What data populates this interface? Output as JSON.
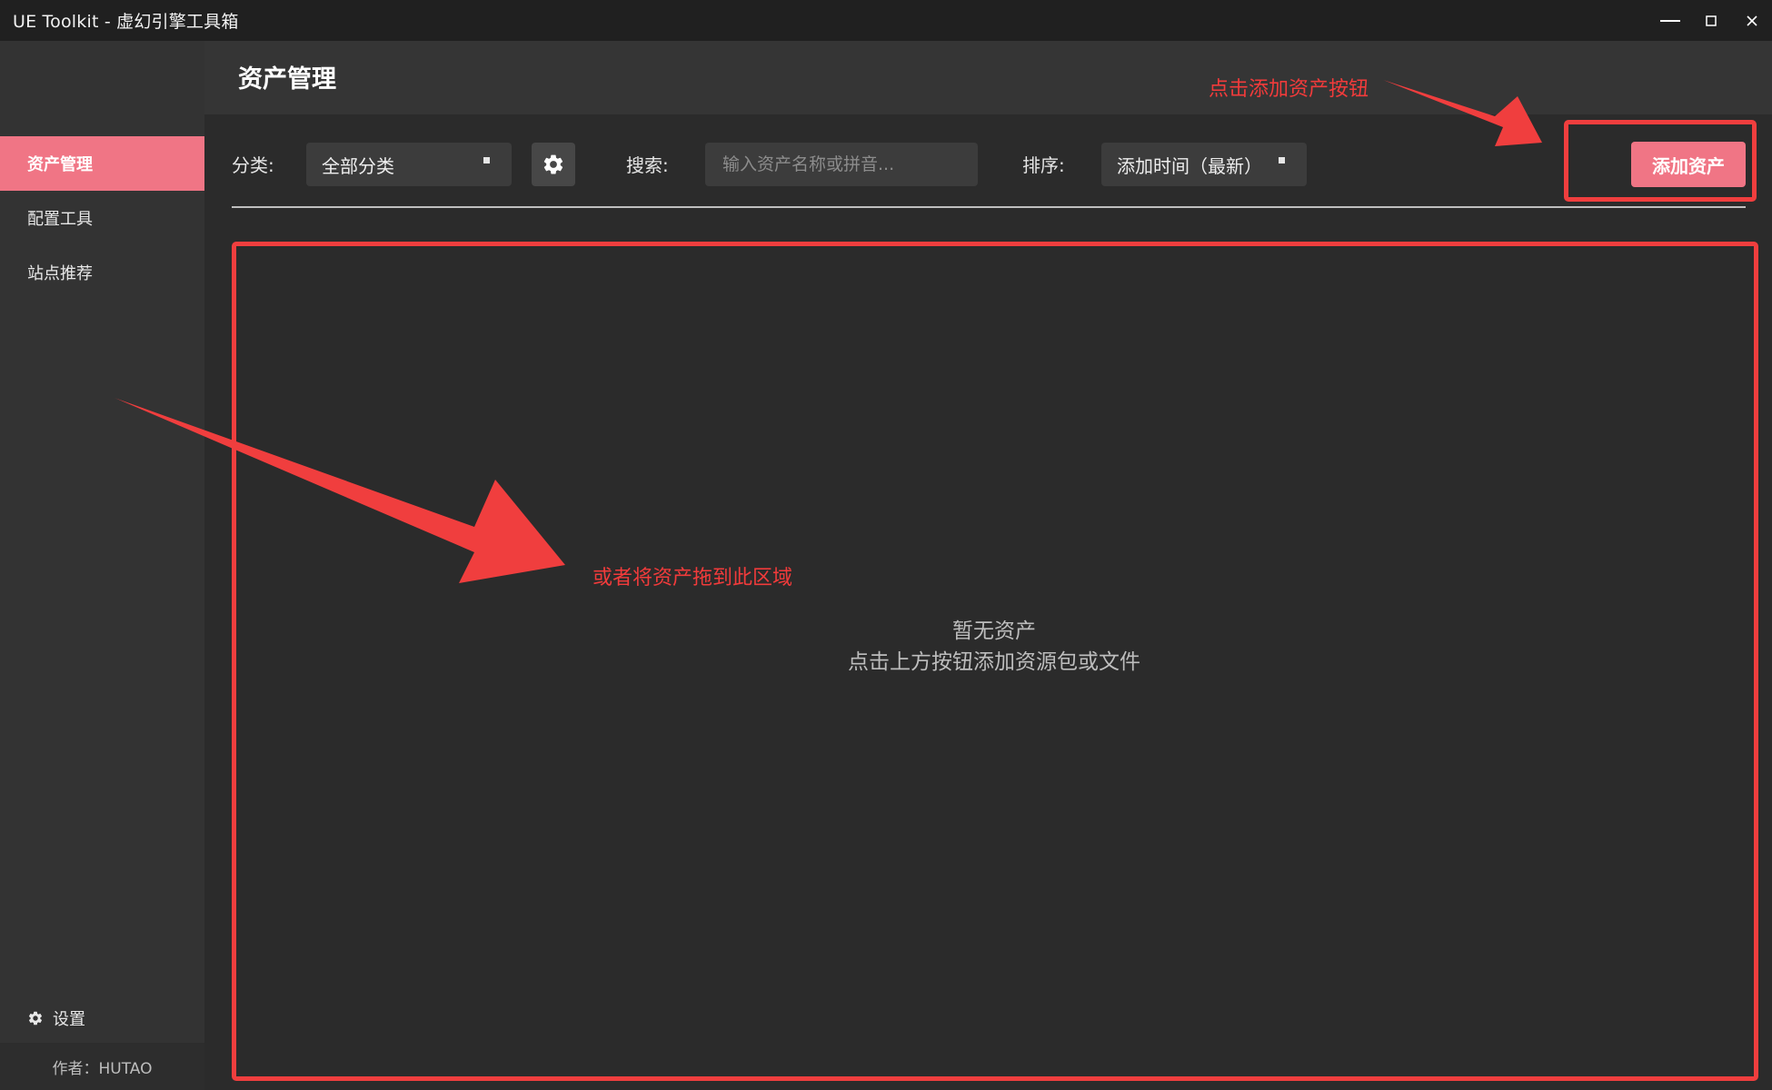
{
  "window": {
    "title": "UE Toolkit - 虚幻引擎工具箱",
    "controls": [
      "minimize-icon",
      "maximize-icon",
      "close-icon"
    ]
  },
  "sidebar": {
    "items": [
      {
        "label": "资产管理",
        "active": true
      },
      {
        "label": "配置工具",
        "active": false
      },
      {
        "label": "站点推荐",
        "active": false
      }
    ],
    "settings_label": "设置",
    "settings_icon": "gear-icon",
    "author": "作者：HUTAO"
  },
  "header": {
    "title": "资产管理"
  },
  "toolbar": {
    "category_label": "分类:",
    "category_value": "全部分类",
    "category_settings_icon": "gear-icon",
    "search_label": "搜索:",
    "search_placeholder": "输入资产名称或拼音...",
    "search_value": "",
    "sort_label": "排序:",
    "sort_value": "添加时间（最新）",
    "add_button_label": "添加资产"
  },
  "empty_state": {
    "line1": "暂无资产",
    "line2": "点击上方按钮添加资源包或文件"
  },
  "annotations": {
    "add_button_hint": "点击添加资产按钮",
    "drop_hint": "或者将资产拖到此区域",
    "color": "#f03e3e"
  },
  "colors": {
    "accent": "#f07585",
    "background": "#2b2b2b",
    "sidebar": "#333333",
    "titlebar": "#202020"
  }
}
